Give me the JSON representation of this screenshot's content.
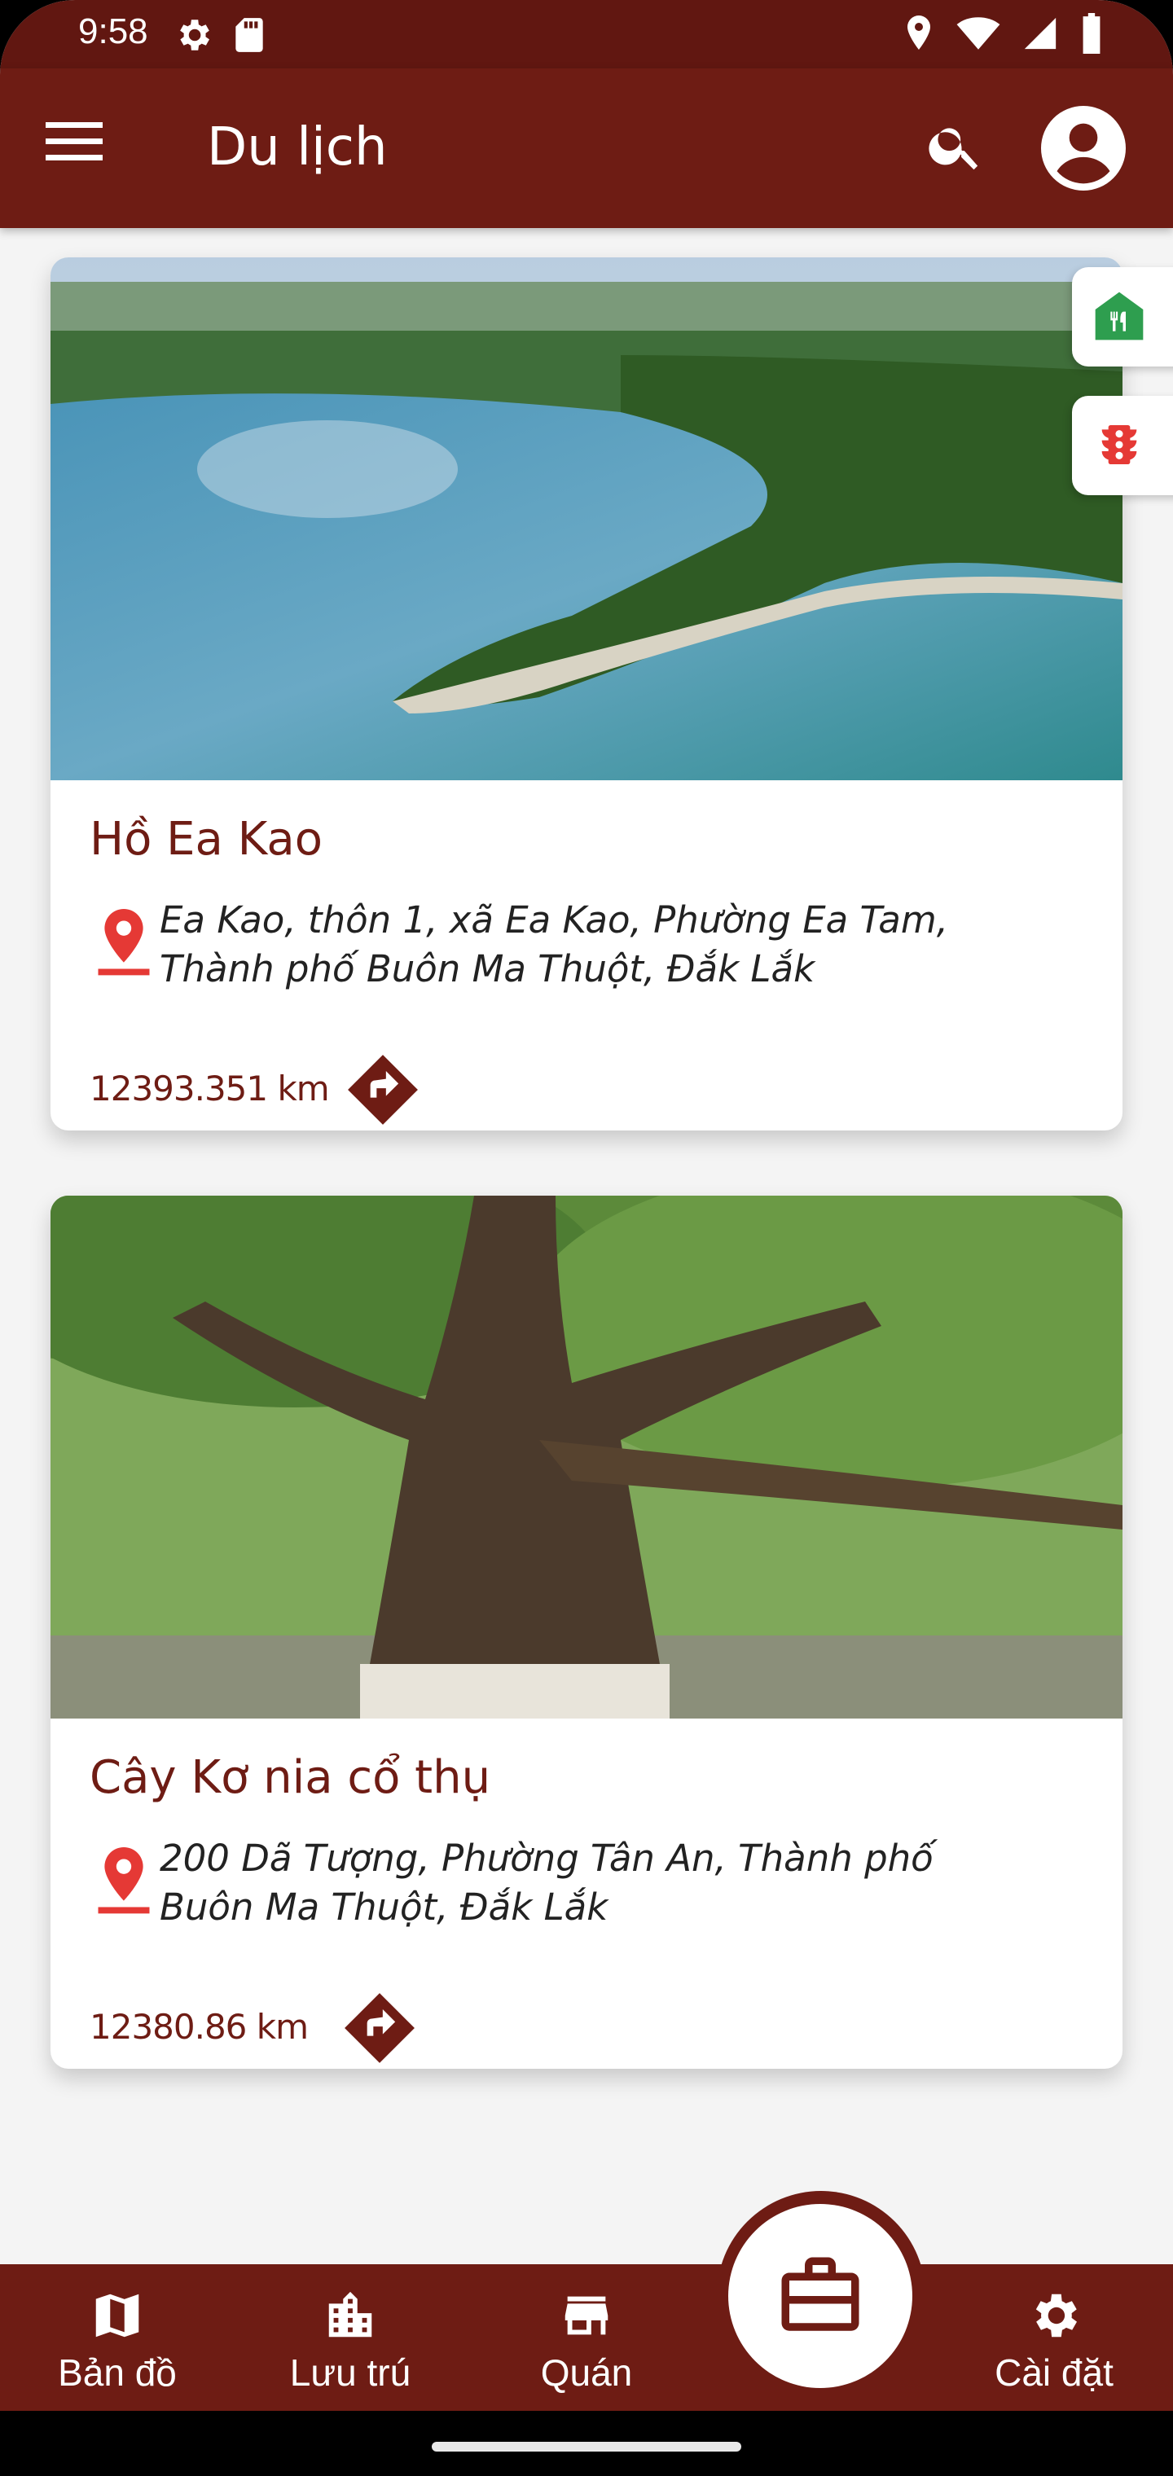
{
  "status_bar": {
    "time": "9:58",
    "icons_left": [
      "gear-icon",
      "sd-card-icon"
    ],
    "icons_right": [
      "location-icon",
      "wifi-icon",
      "signal-icon",
      "battery-icon"
    ]
  },
  "app_bar": {
    "title": "Du lịch",
    "icons": [
      "menu-icon",
      "search-icon",
      "account-icon"
    ]
  },
  "cards": [
    {
      "title": "Hồ Ea Kao",
      "address_line1": "Ea Kao, thôn 1, xã Ea Kao,  Phường Ea Tam,",
      "address_line2": "Thành phố Buôn Ma Thuột, Đắk Lắk",
      "distance": "12393.351 km",
      "image": "lake-with-peninsula-photo"
    },
    {
      "title": "Cây Kơ nia cổ thụ",
      "address_line1": "200 Dã Tượng, Phường Tân An, Thành phố",
      "address_line2": "Buôn Ma Thuột, Đắk Lắk",
      "distance": "12380.86 km",
      "image": "ancient-tree-photo"
    }
  ],
  "side_tabs": [
    {
      "icon": "restaurant-icon",
      "color": "#2e9e4f"
    },
    {
      "icon": "traffic-light-icon",
      "color": "#e53935"
    }
  ],
  "bottom_nav": {
    "items": [
      {
        "label": "Bản đồ",
        "icon": "map-icon"
      },
      {
        "label": "Lưu trú",
        "icon": "building-icon"
      },
      {
        "label": "Quán",
        "icon": "store-icon"
      },
      {
        "label": "Cài đặt",
        "icon": "settings-icon"
      }
    ],
    "center_button_icon": "briefcase-icon"
  },
  "colors": {
    "primary": "#6e1c14",
    "status_bar": "#611711",
    "pin": "#e53935",
    "background": "#f4f4f4"
  }
}
